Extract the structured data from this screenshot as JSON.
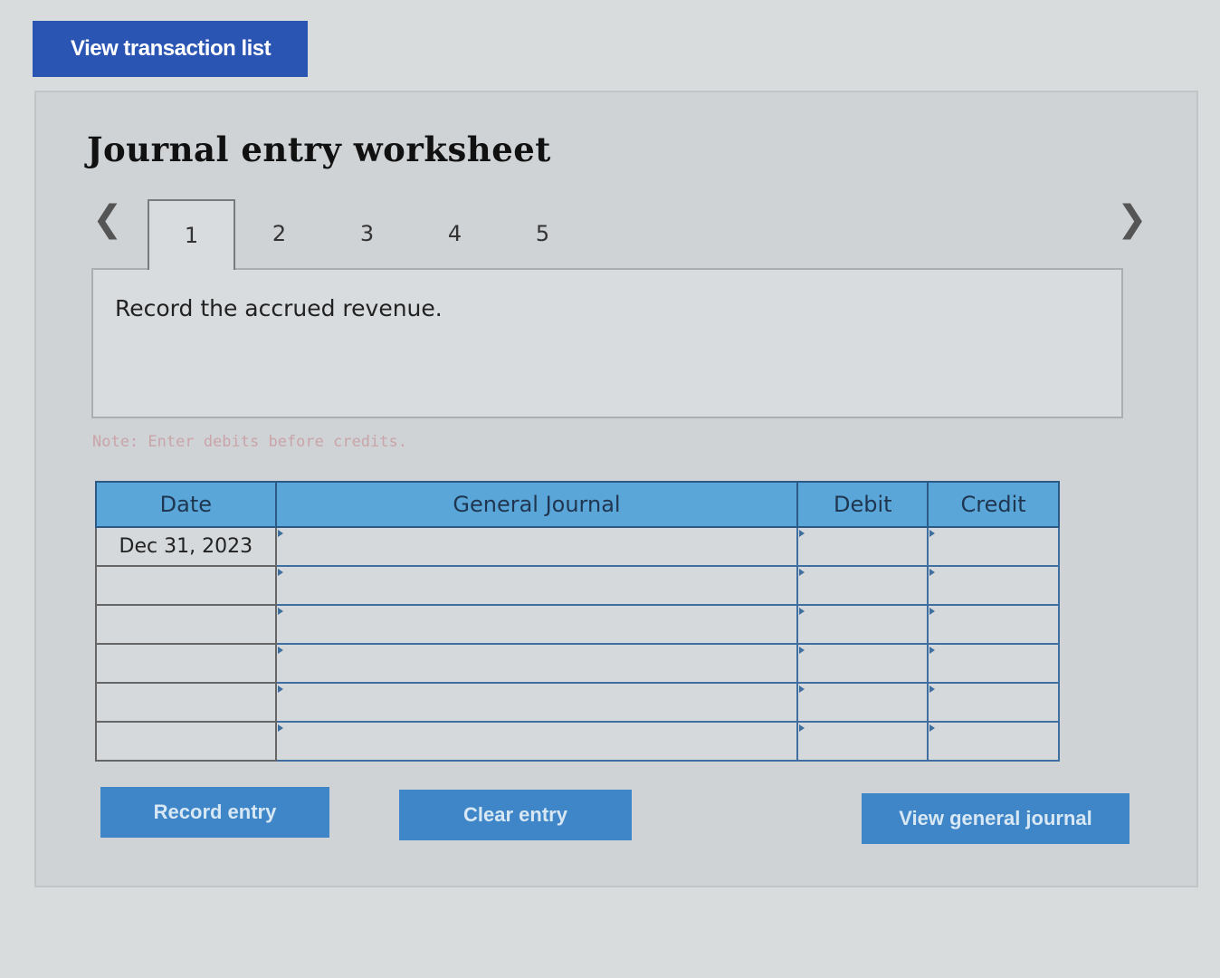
{
  "top_button": {
    "label": "View transaction list"
  },
  "worksheet": {
    "title": "Journal entry worksheet",
    "nav": {
      "prev_icon": "chevron-left",
      "next_icon": "chevron-right"
    },
    "tabs": [
      {
        "label": "1",
        "active": true
      },
      {
        "label": "2",
        "active": false
      },
      {
        "label": "3",
        "active": false
      },
      {
        "label": "4",
        "active": false
      },
      {
        "label": "5",
        "active": false
      }
    ],
    "prompt": "Record the accrued revenue.",
    "note": "Note: Enter debits before credits."
  },
  "journal_table": {
    "headers": {
      "date": "Date",
      "general_journal": "General Journal",
      "debit": "Debit",
      "credit": "Credit"
    },
    "rows": [
      {
        "date": "Dec 31, 2023",
        "account": "",
        "debit": "",
        "credit": ""
      },
      {
        "date": "",
        "account": "",
        "debit": "",
        "credit": ""
      },
      {
        "date": "",
        "account": "",
        "debit": "",
        "credit": ""
      },
      {
        "date": "",
        "account": "",
        "debit": "",
        "credit": ""
      },
      {
        "date": "",
        "account": "",
        "debit": "",
        "credit": ""
      },
      {
        "date": "",
        "account": "",
        "debit": "",
        "credit": ""
      }
    ]
  },
  "actions": {
    "record_entry": "Record entry",
    "clear_entry": "Clear entry",
    "view_general_journal": "View general journal"
  },
  "colors": {
    "primary_button": "#2a55b3",
    "action_button": "#3f86c8",
    "table_header": "#5aa6d8",
    "note_text": "#c9a4a8"
  }
}
